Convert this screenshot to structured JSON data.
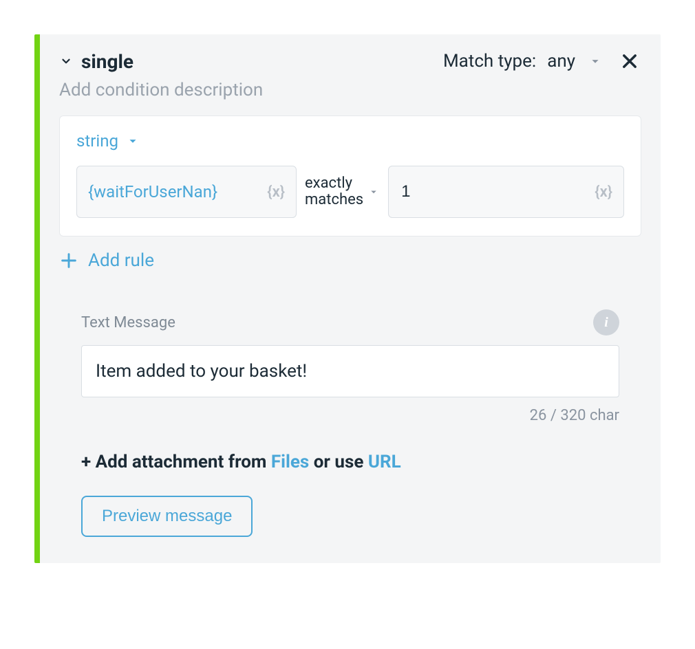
{
  "header": {
    "title": "single",
    "match_type_label": "Match type:",
    "match_type_value": "any",
    "description_placeholder": "Add condition description"
  },
  "rule": {
    "data_type": "string",
    "left_variable": "{waitForUserNan}",
    "operator_line1": "exactly",
    "operator_line2": "matches",
    "right_value": "1"
  },
  "actions": {
    "add_rule_label": "Add rule"
  },
  "message": {
    "section_label": "Text Message",
    "text": "Item added to your basket!",
    "char_count": "26 / 320 char",
    "attach_prefix": "+ Add attachment from ",
    "attach_files": "Files",
    "attach_middle": " or use ",
    "attach_url": "URL",
    "preview_label": "Preview message"
  },
  "icons": {
    "var_brace": "{x}",
    "info": "i"
  }
}
